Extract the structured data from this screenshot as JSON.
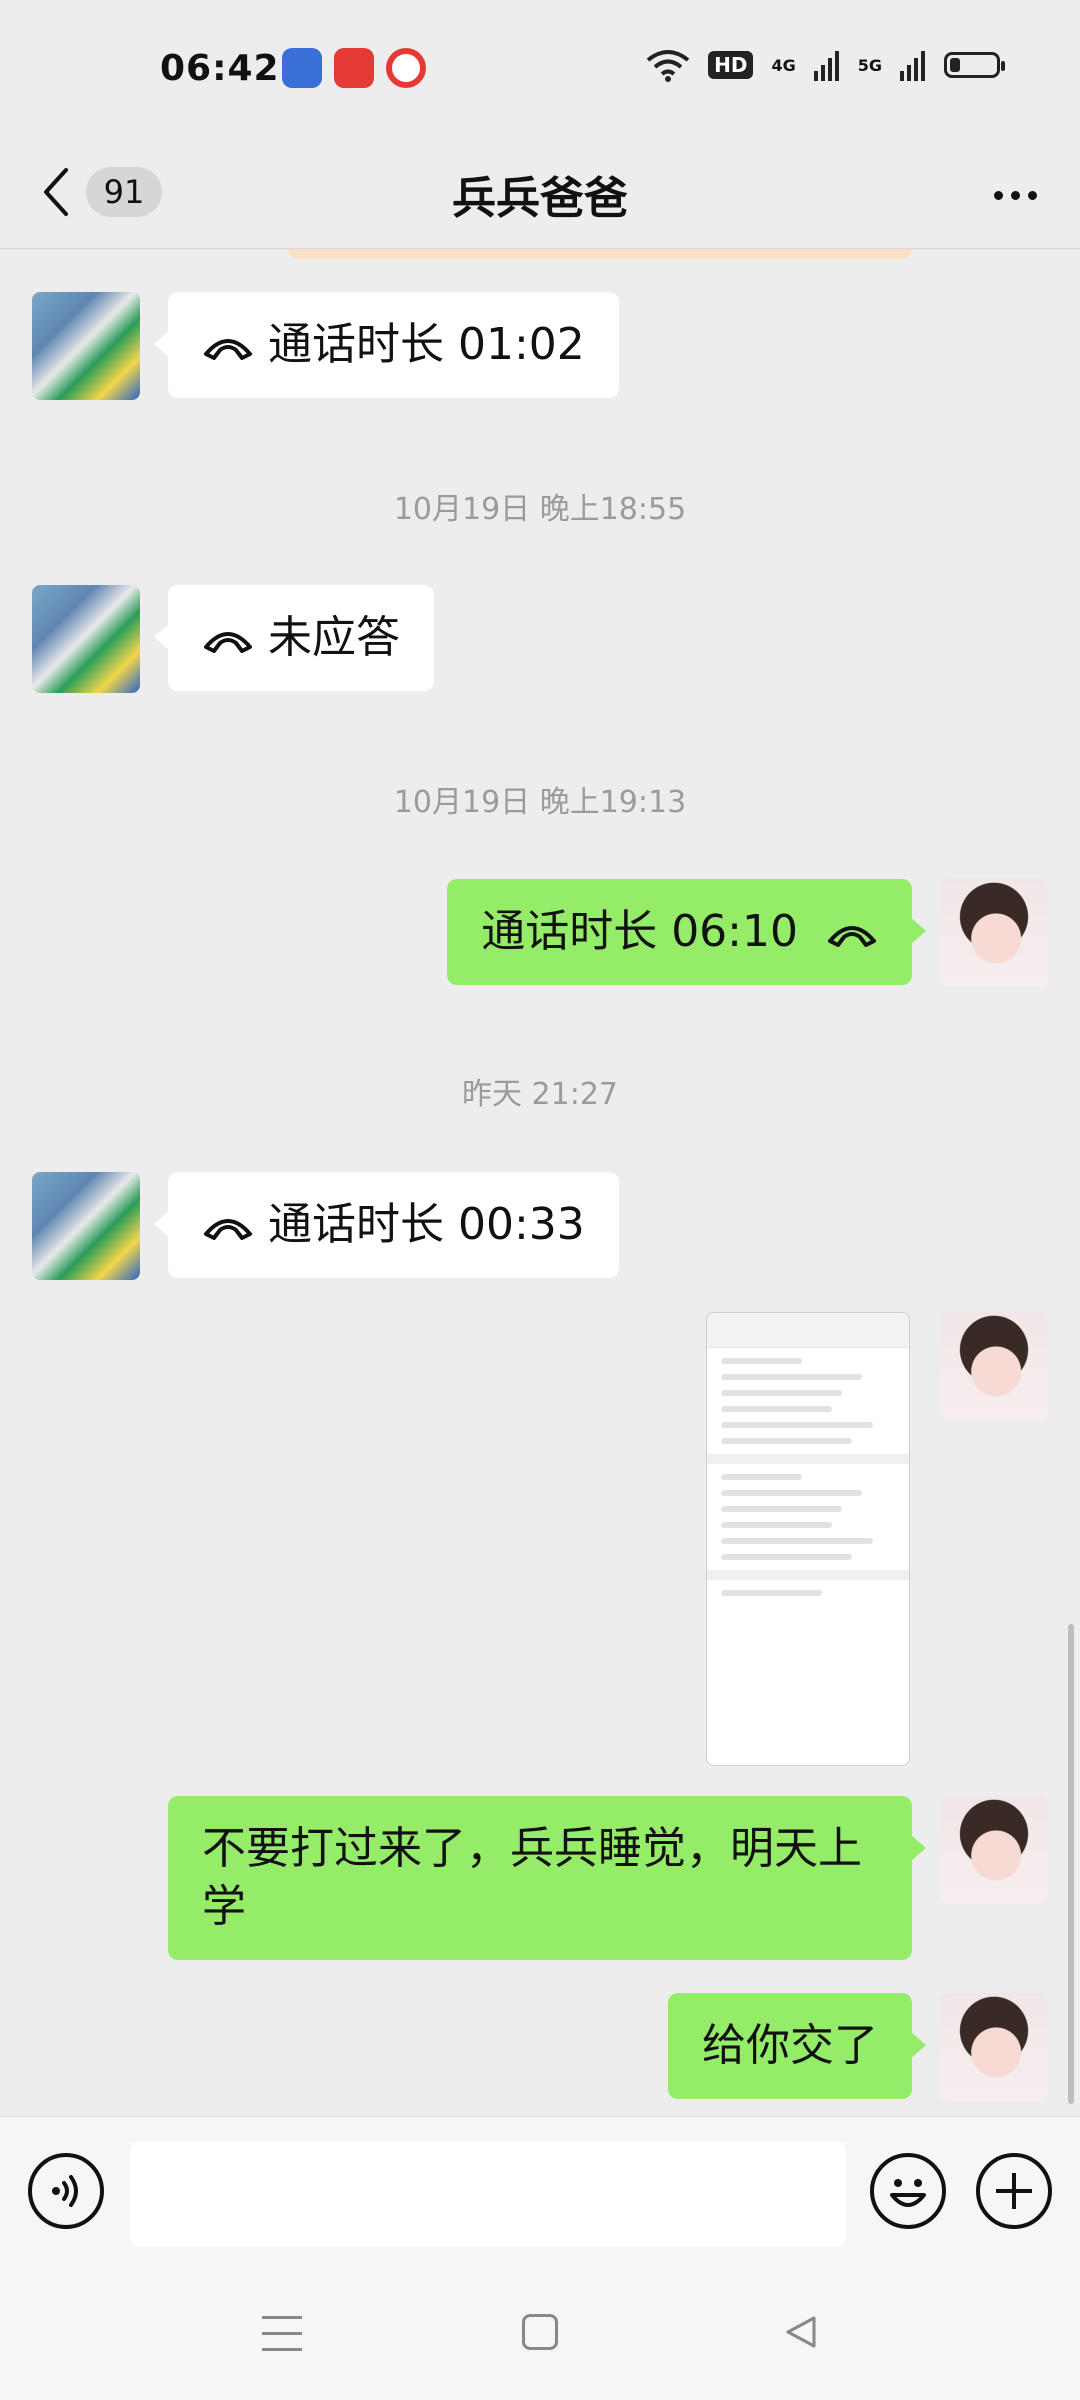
{
  "status_bar": {
    "time": "06:42",
    "network_hd": "HD",
    "network_1": "4G",
    "network_2": "5G",
    "icons": [
      "baidu-app-icon",
      "video-app-icon",
      "music-app-icon",
      "wifi-icon",
      "signal-icon",
      "battery-icon"
    ]
  },
  "header": {
    "unread_count": "91",
    "title": "兵兵爸爸"
  },
  "messages": [
    {
      "side": "in",
      "type": "call",
      "text": "通话时长 01:02"
    },
    {
      "type": "timestamp",
      "text": "10月19日 晚上18:55"
    },
    {
      "side": "in",
      "type": "call",
      "text": "未应答"
    },
    {
      "type": "timestamp",
      "text": "10月19日 晚上19:13"
    },
    {
      "side": "out",
      "type": "call",
      "text": "通话时长 06:10"
    },
    {
      "type": "timestamp",
      "text": "昨天 21:27"
    },
    {
      "side": "in",
      "type": "call",
      "text": "通话时长 00:33"
    },
    {
      "side": "out",
      "type": "image"
    },
    {
      "side": "out",
      "type": "text",
      "text": "不要打过来了，兵兵睡觉，明天上学"
    },
    {
      "side": "out",
      "type": "text",
      "text": "给你交了"
    }
  ],
  "input": {
    "placeholder": ""
  },
  "colors": {
    "outgoing_bubble": "#95ec69",
    "incoming_bubble": "#ffffff",
    "background": "#ededed"
  }
}
